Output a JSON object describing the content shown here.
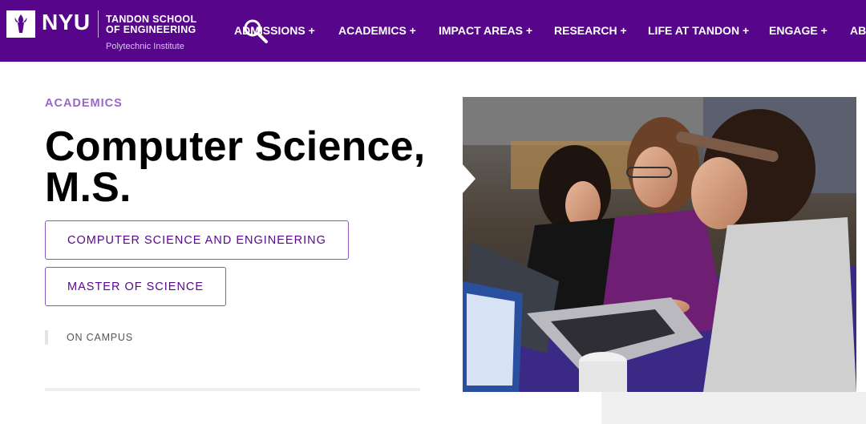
{
  "header": {
    "logo_text": "NYU",
    "school_line1": "TANDON SCHOOL",
    "school_line2": "OF ENGINEERING",
    "subtitle": "Polytechnic Institute",
    "nav": [
      {
        "label": "ADMISSIONS +"
      },
      {
        "label": "ACADEMICS +"
      },
      {
        "label": "IMPACT AREAS +"
      },
      {
        "label": "RESEARCH +"
      },
      {
        "label": "LIFE AT TANDON +"
      },
      {
        "label": "ENGAGE +"
      },
      {
        "label": "ABOUT +"
      }
    ],
    "brand_color": "#57068c"
  },
  "main": {
    "eyebrow": "ACADEMICS",
    "title": "Computer Science, M.S.",
    "tags": [
      {
        "label": "COMPUTER SCIENCE AND ENGINEERING"
      },
      {
        "label": "MASTER OF SCIENCE"
      }
    ],
    "campus": "ON CAMPUS"
  },
  "icons": {
    "search": "search-icon",
    "logo": "nyu-torch-logo-icon"
  }
}
